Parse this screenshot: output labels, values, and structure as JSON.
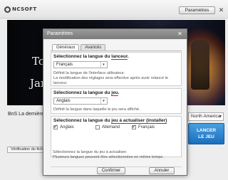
{
  "launcher": {
    "logo_text": "NCSOFT",
    "params_button": "Paramètres",
    "close_glyph": "✕",
    "banner_line1": "To",
    "banner_line2": "Jan",
    "news_text": "BnS La dernière v",
    "verify_button": "Vérification du fich",
    "region": "North America",
    "region_arrow": "▾",
    "launch_line1": "LANCER",
    "launch_line2": "LE JEU"
  },
  "dialog": {
    "title": "Paramètres",
    "close_glyph": "✕",
    "tabs": [
      {
        "label": "Généraux",
        "active": true
      },
      {
        "label": "Avancés",
        "active": false
      }
    ],
    "launcher_section": {
      "heading_prefix": "Sélectionnez la langue du ",
      "heading_highlight": "lanceur",
      "heading_suffix": ".",
      "selected": "Français",
      "arrow": "▾",
      "desc_line1": "Définit la langue de l'interface utilisateur.",
      "desc_line2": "La modification des réglages sera effective après avoir relancé le",
      "desc_line3": "lanceur."
    },
    "game_section": {
      "heading_prefix": "Sélectionnez la langue du ",
      "heading_highlight": "jeu",
      "heading_suffix": ".",
      "selected": "Anglais",
      "arrow": "▾",
      "desc": "Définit la langue dans laquelle le jeu sera affiché."
    },
    "update_section": {
      "heading_prefix": "Sélectionnez la langue du ",
      "heading_highlight1": "jeu",
      "heading_mid": " à actualiser ",
      "heading_highlight2": "(installer)",
      "options": [
        {
          "label": "Anglais",
          "checked": true
        },
        {
          "label": "Allemand",
          "checked": false
        },
        {
          "label": "Français",
          "checked": true
        }
      ]
    },
    "bottom_desc_line1": "Sélectionnez la langue du jeu à actualiser.",
    "bottom_desc_line2": "Plusieurs langues peuvent être sélectionnées en même temps.",
    "confirm_button": "Confirmer",
    "cancel_button": "Annuler"
  },
  "colors": {
    "highlight_underline": "#e01515",
    "launch_button": "#1a6fbf"
  }
}
